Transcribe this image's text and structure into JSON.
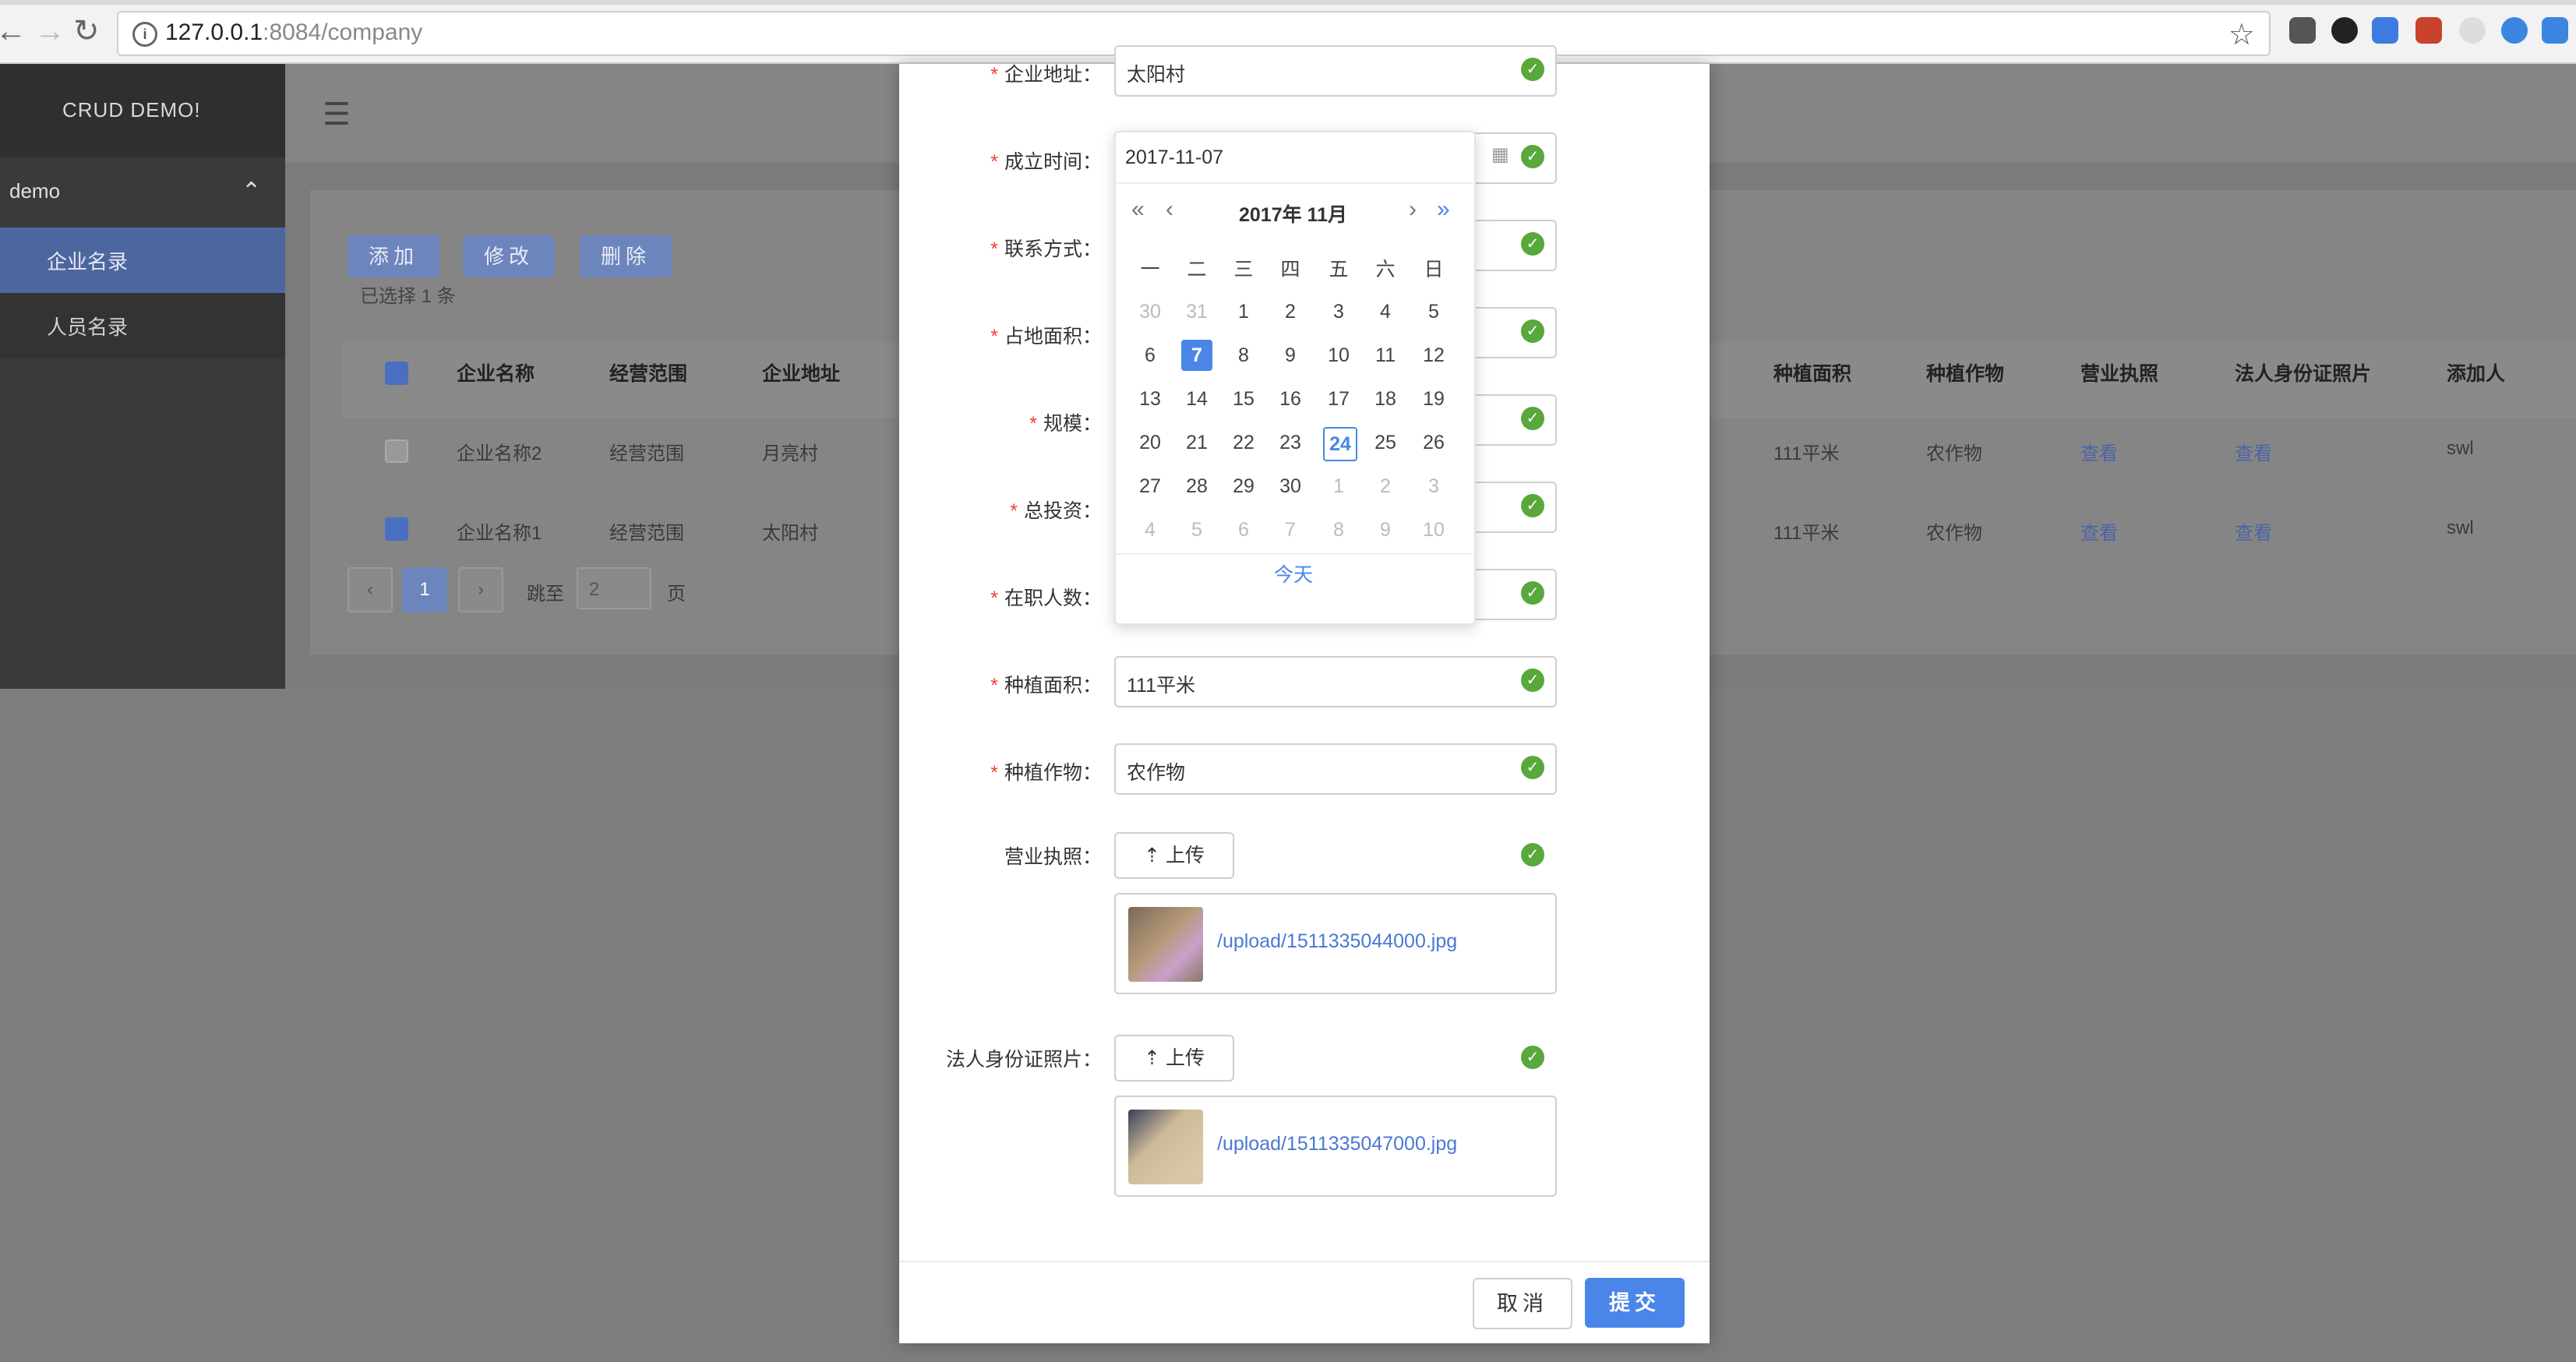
{
  "browser": {
    "url_host": "127.0.0.1",
    "url_path": ":8084/company"
  },
  "app": {
    "title": "CRUD DEMO!",
    "menu_group": "demo",
    "menu_items": [
      "企业名录",
      "人员名录"
    ]
  },
  "toolbar": {
    "add_label": "添加",
    "edit_label": "修改",
    "delete_label": "删除",
    "selected_info": "已选择 1 条"
  },
  "table": {
    "left_headers": [
      "企业名称",
      "经营范围",
      "企业地址"
    ],
    "right_headers": [
      "种植面积",
      "种植作物",
      "营业执照",
      "法人身份证照片",
      "添加人"
    ],
    "rows": [
      {
        "name": "企业名称2",
        "scope": "经营范围",
        "addr": "月亮村",
        "area": "111平米",
        "crop": "农作物",
        "license": "查看",
        "idcard": "查看",
        "adder": "swl",
        "checked": false
      },
      {
        "name": "企业名称1",
        "scope": "经营范围",
        "addr": "太阳村",
        "area": "111平米",
        "crop": "农作物",
        "license": "查看",
        "idcard": "查看",
        "adder": "swl",
        "checked": true
      }
    ]
  },
  "pagination": {
    "prev": "‹",
    "current": "1",
    "next": "›",
    "jump_label": "跳至",
    "jump_value": "2",
    "page_suffix": "页"
  },
  "form": {
    "fields": [
      {
        "label": "企业地址",
        "value": "太阳村",
        "required": true
      },
      {
        "label": "成立时间",
        "value": "",
        "required": true
      },
      {
        "label": "联系方式",
        "value": "",
        "required": true
      },
      {
        "label": "占地面积",
        "value": "",
        "required": true
      },
      {
        "label": "规模",
        "value": "",
        "required": true
      },
      {
        "label": "总投资",
        "value": "",
        "required": true
      },
      {
        "label": "在职人数",
        "value": "",
        "required": true
      },
      {
        "label": "种植面积",
        "value": "111平米",
        "required": true
      },
      {
        "label": "种植作物",
        "value": "农作物",
        "required": true
      }
    ],
    "license_label": "营业执照",
    "idcard_label": "法人身份证照片",
    "upload_label": "上传",
    "license_file": "/upload/1511335044000.jpg",
    "idcard_file": "/upload/1511335047000.jpg",
    "colon": "：",
    "required_mark": "*"
  },
  "datepicker": {
    "input_value": "2017-11-07",
    "title": "2017年 11月",
    "prev_year": "«",
    "prev_month": "‹",
    "next_month": "›",
    "next_year": "»",
    "weekdays": [
      "一",
      "二",
      "三",
      "四",
      "五",
      "六",
      "日"
    ],
    "weeks": [
      [
        "30",
        "31",
        "1",
        "2",
        "3",
        "4",
        "5"
      ],
      [
        "6",
        "7",
        "8",
        "9",
        "10",
        "11",
        "12"
      ],
      [
        "13",
        "14",
        "15",
        "16",
        "17",
        "18",
        "19"
      ],
      [
        "20",
        "21",
        "22",
        "23",
        "24",
        "25",
        "26"
      ],
      [
        "27",
        "28",
        "29",
        "30",
        "1",
        "2",
        "3"
      ],
      [
        "4",
        "5",
        "6",
        "7",
        "8",
        "9",
        "10"
      ]
    ],
    "selected_day": "7",
    "today_day": "24",
    "today_label": "今天"
  },
  "dialog": {
    "cancel_label": "取消",
    "submit_label": "提交"
  },
  "colors": {
    "primary": "#4a86e8",
    "success": "#58a83b",
    "required": "#f04134"
  }
}
